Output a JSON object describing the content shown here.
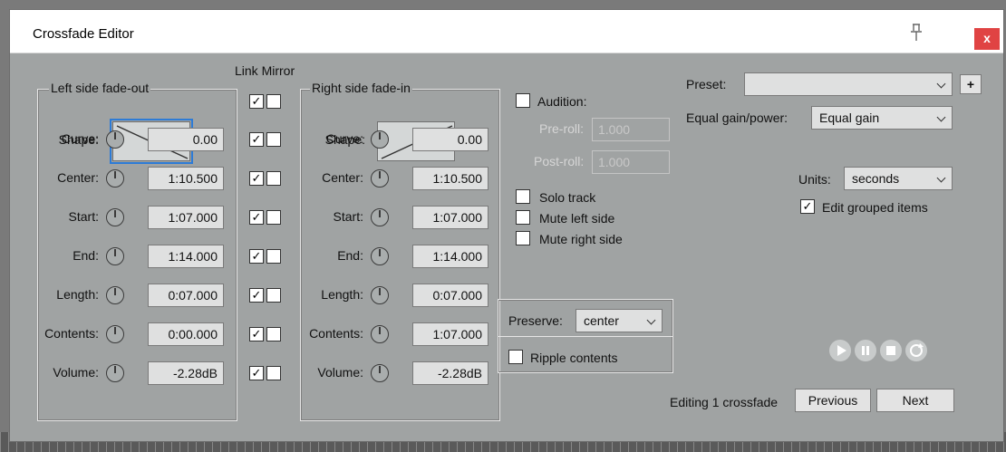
{
  "window": {
    "title": "Crossfade Editor",
    "close_label": "x"
  },
  "header": {
    "link_mirror_label": "Link Mirror"
  },
  "left": {
    "group_label": "Left side fade-out",
    "shape_label": "Shape:",
    "rows": [
      {
        "label": "Curve:",
        "value": "0.00"
      },
      {
        "label": "Center:",
        "value": "1:10.500"
      },
      {
        "label": "Start:",
        "value": "1:07.000"
      },
      {
        "label": "End:",
        "value": "1:14.000"
      },
      {
        "label": "Length:",
        "value": "0:07.000"
      },
      {
        "label": "Contents:",
        "value": "0:00.000"
      },
      {
        "label": "Volume:",
        "value": "-2.28dB"
      }
    ]
  },
  "right": {
    "group_label": "Right side fade-in",
    "shape_label": "Shape:",
    "rows": [
      {
        "label": "Curve:",
        "value": "0.00"
      },
      {
        "label": "Center:",
        "value": "1:10.500"
      },
      {
        "label": "Start:",
        "value": "1:07.000"
      },
      {
        "label": "End:",
        "value": "1:14.000"
      },
      {
        "label": "Length:",
        "value": "0:07.000"
      },
      {
        "label": "Contents:",
        "value": "1:07.000"
      },
      {
        "label": "Volume:",
        "value": "-2.28dB"
      }
    ]
  },
  "link_checks": [
    true,
    true,
    true,
    true,
    true,
    true,
    true,
    true
  ],
  "mirror_checks": [
    false,
    false,
    false,
    false,
    false,
    false,
    false,
    false
  ],
  "audition": {
    "label": "Audition:",
    "checked": false,
    "preroll_label": "Pre-roll:",
    "preroll_value": "1.000",
    "postroll_label": "Post-roll:",
    "postroll_value": "1.000"
  },
  "options": {
    "solo_track": {
      "label": "Solo track",
      "checked": false
    },
    "mute_left": {
      "label": "Mute left side",
      "checked": false
    },
    "mute_right": {
      "label": "Mute right side",
      "checked": false
    }
  },
  "preserve": {
    "label": "Preserve:",
    "value": "center"
  },
  "ripple": {
    "label": "Ripple contents",
    "checked": false
  },
  "preset": {
    "label": "Preset:",
    "value": "",
    "add_label": "+"
  },
  "equal_gain": {
    "label": "Equal gain/power:",
    "value": "Equal gain"
  },
  "units": {
    "label": "Units:",
    "value": "seconds"
  },
  "edit_grouped": {
    "label": "Edit grouped items",
    "checked": true
  },
  "footer": {
    "status": "Editing 1 crossfade",
    "previous_label": "Previous",
    "next_label": "Next"
  },
  "colors": {
    "focus": "#2d7bd6",
    "close": "#e04343",
    "dialog_bg": "#a0a3a3"
  }
}
